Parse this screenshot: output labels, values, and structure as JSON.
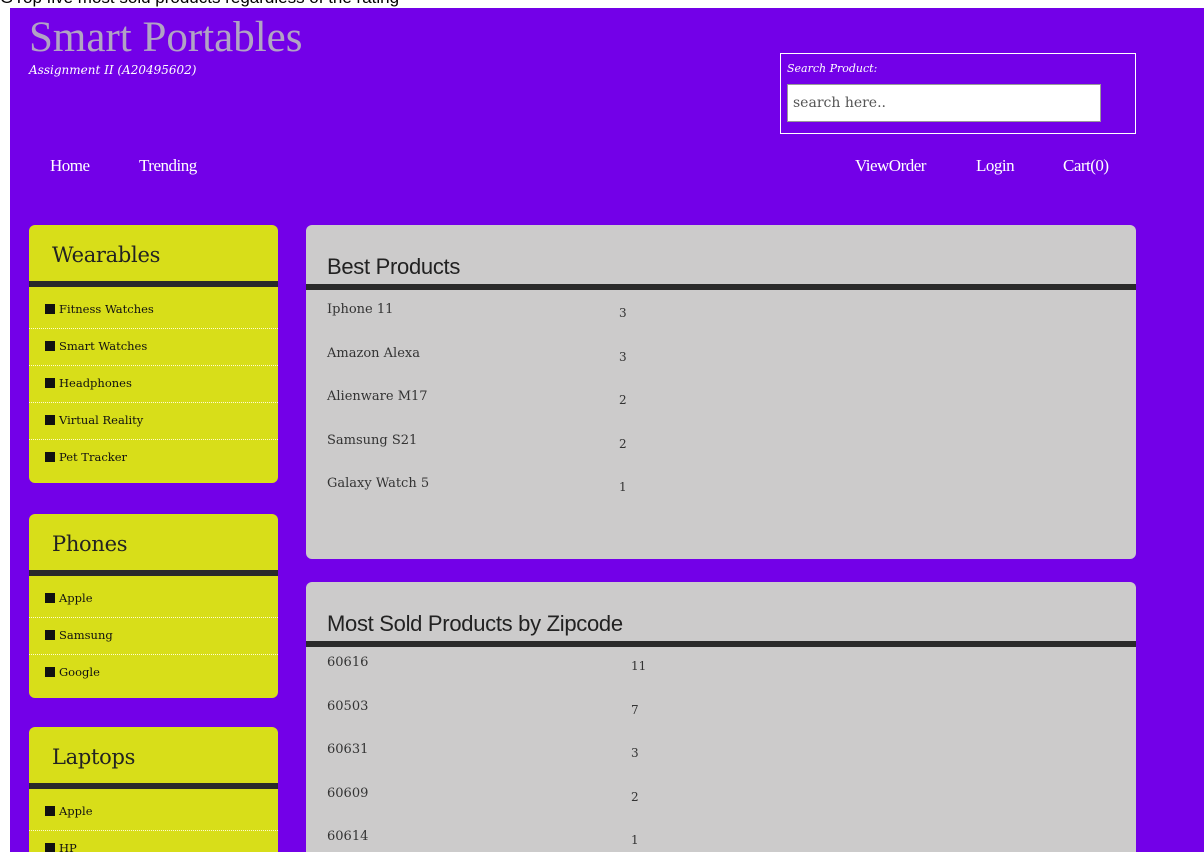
{
  "caption": "GYop five most sold products regardless of the rating",
  "header": {
    "title": "Smart Portables",
    "subtitle": "Assignment II (A20495602)",
    "search_label": "Search Product:",
    "search_placeholder": "search here.."
  },
  "nav": {
    "home": "Home",
    "trending": "Trending",
    "vieworder": "ViewOrder",
    "login": "Login",
    "cart": "Cart(0)"
  },
  "sidebar": [
    {
      "title": "Wearables",
      "items": [
        "Fitness Watches",
        "Smart Watches",
        "Headphones",
        "Virtual Reality",
        "Pet Tracker"
      ]
    },
    {
      "title": "Phones",
      "items": [
        "Apple",
        "Samsung",
        "Google"
      ]
    },
    {
      "title": "Laptops",
      "items": [
        "Apple",
        "HP"
      ]
    }
  ],
  "best_products": {
    "title": "Best Products",
    "rows": [
      {
        "name": "Iphone 11",
        "count": "3"
      },
      {
        "name": "Amazon Alexa",
        "count": "3"
      },
      {
        "name": "Alienware M17",
        "count": "2"
      },
      {
        "name": "Samsung S21",
        "count": "2"
      },
      {
        "name": "Galaxy Watch 5",
        "count": "1"
      }
    ]
  },
  "zipcode_products": {
    "title": "Most Sold Products by Zipcode",
    "rows": [
      {
        "zip": "60616",
        "count": "11"
      },
      {
        "zip": "60503",
        "count": "7"
      },
      {
        "zip": "60631",
        "count": "3"
      },
      {
        "zip": "60609",
        "count": "2"
      },
      {
        "zip": "60614",
        "count": "1"
      }
    ]
  },
  "colors": {
    "background": "#7300e8",
    "sidebar_box": "#d8de19",
    "content_box": "#cccbcb",
    "title": "#b1a3c4"
  }
}
